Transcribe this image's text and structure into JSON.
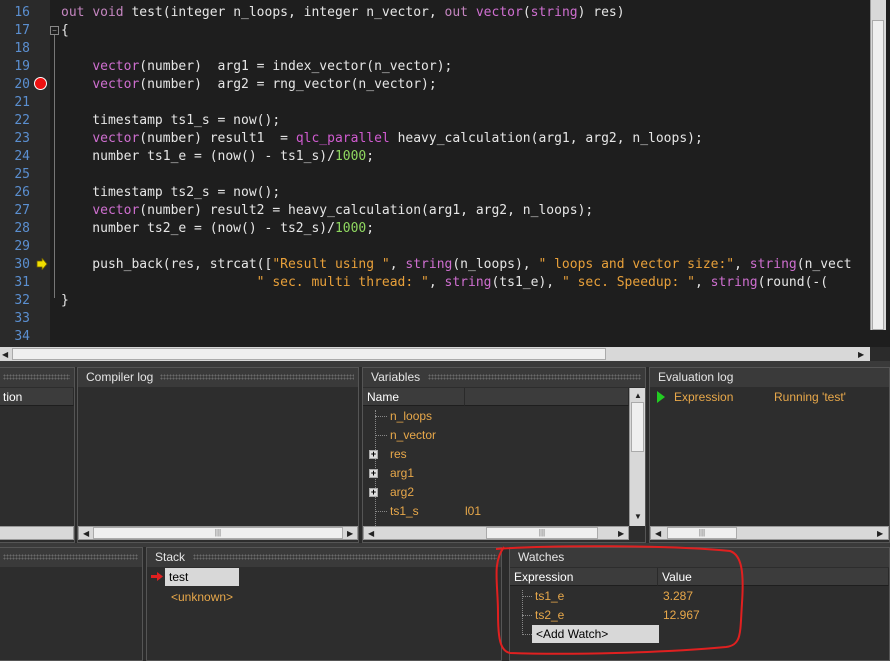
{
  "editor": {
    "line_numbers": [
      "16",
      "17",
      "18",
      "19",
      "20",
      "21",
      "22",
      "23",
      "24",
      "25",
      "26",
      "27",
      "28",
      "29",
      "30",
      "31",
      "32",
      "33",
      "34"
    ]
  },
  "panels": {
    "compiler_log": {
      "title": "Compiler log"
    },
    "variables": {
      "title": "Variables",
      "col_name": "Name",
      "items": [
        "n_loops",
        "n_vector",
        "res",
        "arg1",
        "arg2",
        "ts1_s"
      ],
      "ts1_s_value": "l01",
      "partial_col": "tion"
    },
    "evaluation_log": {
      "title": "Evaluation log",
      "col_expression": "Expression",
      "col_status": "Running 'test'"
    },
    "stack": {
      "title": "Stack",
      "frames": [
        "test",
        "<unknown>"
      ]
    },
    "watches": {
      "title": "Watches",
      "col_expression": "Expression",
      "col_value": "Value",
      "items": [
        {
          "expression": "ts1_e",
          "value": "3.287"
        },
        {
          "expression": "ts2_e",
          "value": "12.967"
        }
      ],
      "add_watch": "<Add Watch>"
    }
  },
  "icons": {
    "breakpoint": "breakpoint-icon",
    "current_line": "current-line-arrow-icon",
    "play": "play-icon",
    "stack_pointer": "stack-arrow-icon"
  },
  "colors": {
    "breakpoint": "#e11111",
    "annotation": "#e02020",
    "tree_text": "#e8a84a"
  }
}
